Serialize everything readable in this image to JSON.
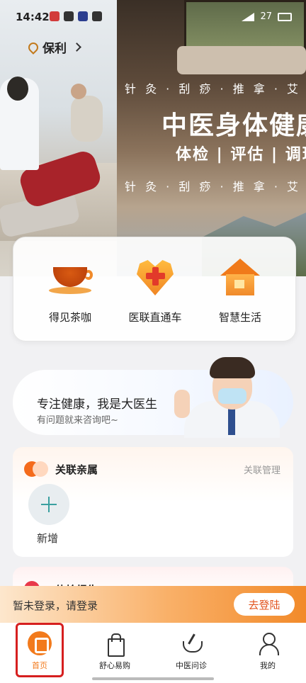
{
  "status_bar": {
    "time": "14:42",
    "battery": "27"
  },
  "location": {
    "city": "保利"
  },
  "banner": {
    "services_line": "针 灸 · 刮 痧 · 推 拿 · 艾 灸",
    "title": "中医身体健康",
    "subtitle": "体检 | 评估 | 调理"
  },
  "quick_services": [
    {
      "label": "得见茶咖",
      "icon": "tea-cup-icon"
    },
    {
      "label": "医联直通车",
      "icon": "medical-heart-icon"
    },
    {
      "label": "智慧生活",
      "icon": "smart-house-icon"
    }
  ],
  "doctor_banner": {
    "title": "专注健康，我是大医生",
    "subtitle": "有问题就来咨询吧~"
  },
  "relatives": {
    "title": "关联亲属",
    "manage_label": "关联管理",
    "add_label": "新增"
  },
  "report": {
    "title": "体检报告"
  },
  "login_bar": {
    "message": "暂未登录，请登录",
    "button_label": "去登陆"
  },
  "bottom_nav": [
    {
      "label": "首页",
      "icon": "home-icon",
      "active": true
    },
    {
      "label": "舒心易购",
      "icon": "shopping-bag-icon"
    },
    {
      "label": "中医问诊",
      "icon": "mortar-pestle-icon"
    },
    {
      "label": "我的",
      "icon": "user-icon"
    }
  ],
  "colors": {
    "accent": "#f27a1c",
    "highlight": "#d61f1f"
  }
}
